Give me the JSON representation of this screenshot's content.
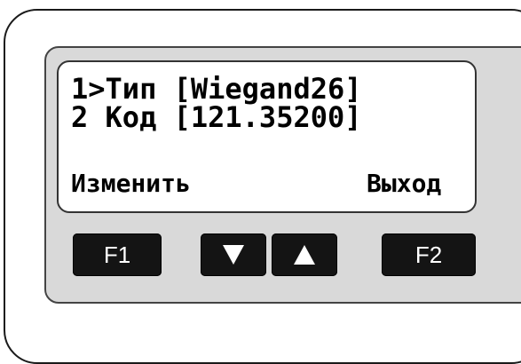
{
  "display": {
    "line1": "1>Тип [Wiegand26]",
    "line2": "2 Код [121.35200]",
    "softkey_left": "Изменить",
    "softkey_right": "Выход"
  },
  "keys": {
    "f1_label": "F1",
    "f2_label": "F2",
    "down_icon": "triangle-down",
    "up_icon": "triangle-up"
  },
  "colors": {
    "key_background": "#141414",
    "panel_background": "#d9d9d9",
    "screen_background": "#ffffff"
  }
}
